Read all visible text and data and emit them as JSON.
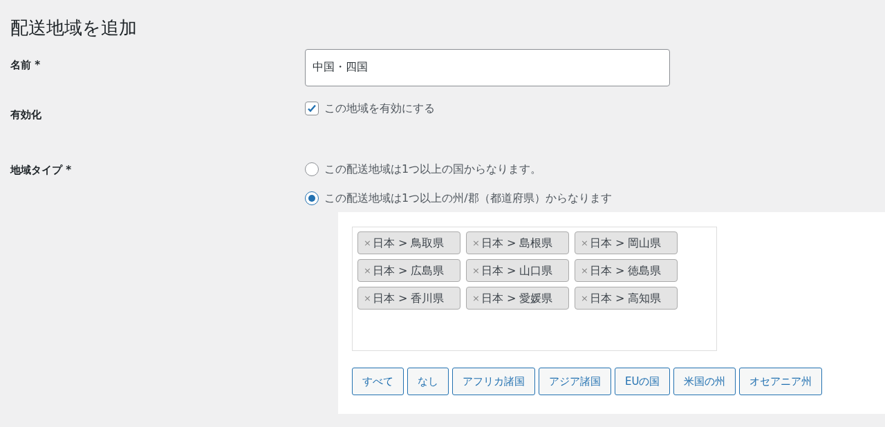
{
  "title": "配送地域を追加",
  "name_field": {
    "label": "名前 *",
    "value": "中国・四国"
  },
  "enabled_field": {
    "label": "有効化",
    "option": {
      "label": "この地域を有効にする",
      "checked": true
    }
  },
  "region_type_field": {
    "label": "地域タイプ *",
    "options": [
      {
        "label": "この配送地域は1つ以上の国からなります。",
        "selected": false
      },
      {
        "label": "この配送地域は1つ以上の州/郡（都道府県）からなります",
        "selected": true
      }
    ]
  },
  "selected_regions": [
    {
      "remove": "×",
      "label": "日本 > 鳥取県"
    },
    {
      "remove": "×",
      "label": "日本 > 島根県"
    },
    {
      "remove": "×",
      "label": "日本 > 岡山県"
    },
    {
      "remove": "×",
      "label": "日本 > 広島県"
    },
    {
      "remove": "×",
      "label": "日本 > 山口県"
    },
    {
      "remove": "×",
      "label": "日本 > 徳島県"
    },
    {
      "remove": "×",
      "label": "日本 > 香川県"
    },
    {
      "remove": "×",
      "label": "日本 > 愛媛県"
    },
    {
      "remove": "×",
      "label": "日本 > 高知県"
    }
  ],
  "quick_buttons": [
    "すべて",
    "なし",
    "アフリカ諸国",
    "アジア諸国",
    "EUの国",
    "米国の州",
    "オセアニア州"
  ]
}
